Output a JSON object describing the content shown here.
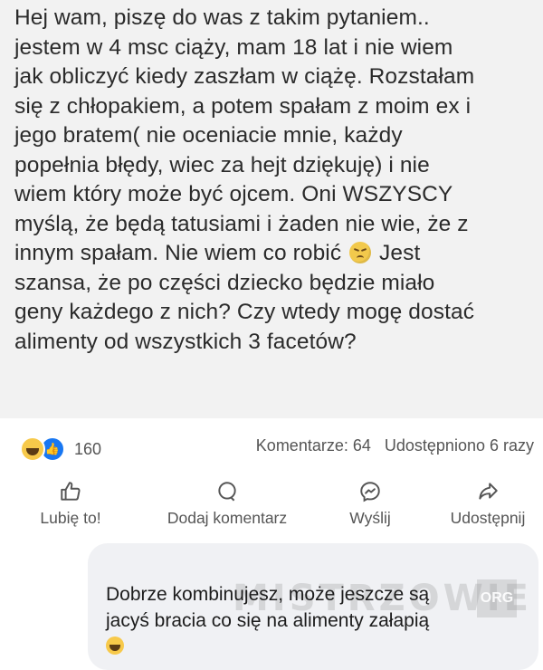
{
  "post": {
    "text_lines": [
      "Hej wam, piszę do was z takim pytaniem..",
      "jestem w 4 msc ciąży, mam 18 lat i nie wiem",
      "jak obliczyć kiedy zaszłam w ciążę. Rozstałam",
      "się z chłopakiem, a potem spałam z moim ex i",
      "jego bratem( nie oceniacie mnie, każdy",
      "popełnia błędy, wiec za hejt dziękuję)  i nie",
      "wiem który może być ojcem. Oni WSZYSCY",
      "myślą, że będą tatusiami i żaden nie wie, że  z",
      "innym spałam. Nie wiem co robić",
      "Jest",
      "szansa, że po części dziecko będzie miało",
      "geny każdego z nich? Czy wtedy mogę dostać",
      "alimenty od wszystkich 3 facetów?"
    ],
    "inline_emoji": "worried-face-icon"
  },
  "stats": {
    "reaction_count": "160",
    "comments": "Komentarze: 64",
    "shares": "Udostępniono 6 razy",
    "reaction_icons": [
      "haha-reaction-icon",
      "like-reaction-icon"
    ]
  },
  "actions": {
    "like": "Lubię to!",
    "comment": "Dodaj komentarz",
    "send": "Wyślij",
    "share": "Udostępnij"
  },
  "comment": {
    "lines": [
      "Dobrze kombinujesz,  może jeszcze są",
      "jacyś bracia co się na alimenty załapią"
    ],
    "emoji": "laughing-face-icon"
  },
  "watermark": {
    "text": "MISTRZOWIE",
    "badge": "ORG"
  },
  "colors": {
    "post_bg": "#f2f2f2",
    "like_blue": "#1877f2",
    "comment_bubble": "#f0f1f4"
  }
}
